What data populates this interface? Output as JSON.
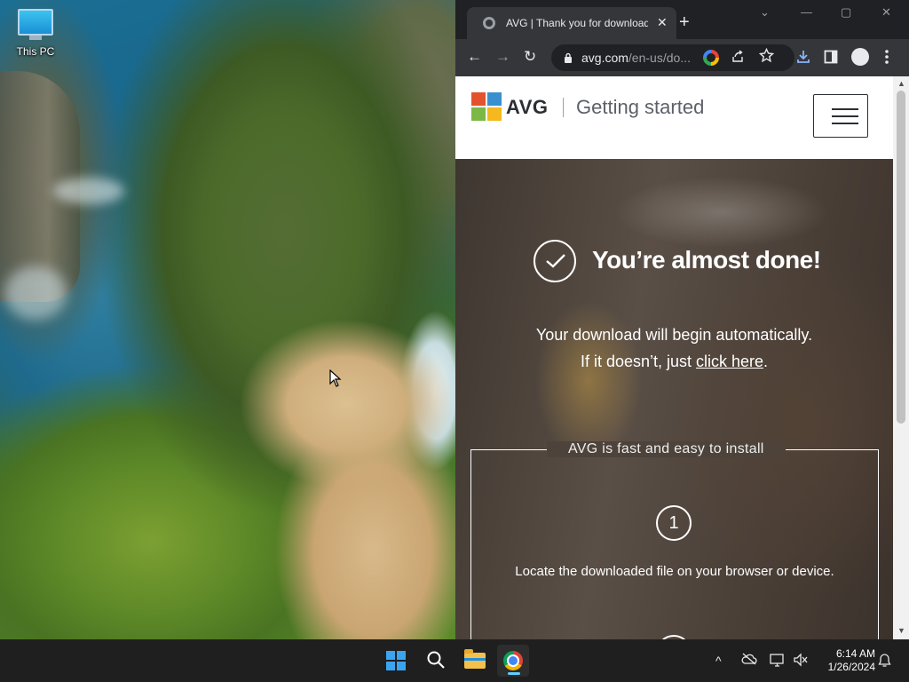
{
  "desktop": {
    "icons": [
      {
        "label": "This PC",
        "icon": "monitor-icon"
      }
    ]
  },
  "browser": {
    "tab": {
      "title": "AVG | Thank you for downloading",
      "close": "✕"
    },
    "new_tab": "+",
    "window_controls": {
      "tab_search": "⌄",
      "minimize": "—",
      "maximize": "▢",
      "close": "✕"
    },
    "toolbar": {
      "back": "←",
      "forward": "→",
      "reload": "↻"
    },
    "omnibox": {
      "url_domain": "avg.com",
      "url_path": "/en-us/do..."
    }
  },
  "page": {
    "header": {
      "brand": "AVG",
      "title": "Getting started"
    },
    "hero": {
      "title": "You’re almost done!",
      "line1": "Your download will begin automatically.",
      "line2_prefix": "If it doesn’t, just ",
      "link_text": "click here",
      "line2_suffix": "."
    },
    "install": {
      "heading": "AVG is fast and easy to install",
      "steps": [
        {
          "number": "1",
          "text": "Locate the downloaded file on your browser or device."
        }
      ]
    }
  },
  "taskbar": {
    "apps": [
      "windows-start",
      "search",
      "file-explorer",
      "chrome"
    ],
    "tray": {
      "chevron": "^"
    },
    "clock": {
      "time": "6:14 AM",
      "date": "1/26/2024"
    }
  },
  "colors": {
    "accent": "#60cdff",
    "hero_bg": "#4d433b",
    "taskbar": "#1f1f1f",
    "browser_dark": "#202124"
  }
}
